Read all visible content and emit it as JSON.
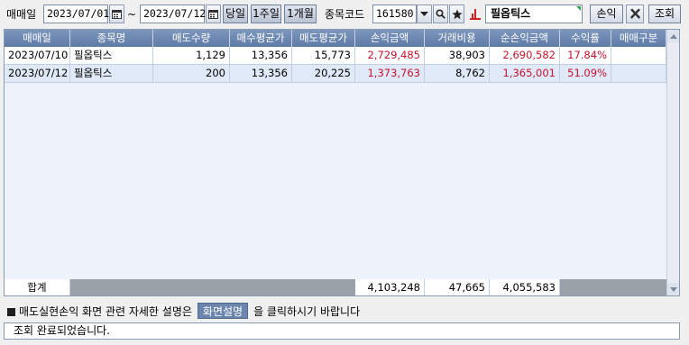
{
  "toolbar": {
    "date_label": "매매일",
    "start_date": "2023/07/01",
    "tilde": "~",
    "end_date": "2023/07/12",
    "btn_today": "당일",
    "btn_1week": "1주일",
    "btn_1month": "1개월",
    "code_label": "종목코드",
    "stock_code": "161580",
    "stock_name": "필옵틱스",
    "btn_profit": "손익",
    "btn_query": "조회"
  },
  "table": {
    "columns": [
      "매매일",
      "종목명",
      "매도수량",
      "매수평균가",
      "매도평균가",
      "손익금액",
      "거래비용",
      "순손익금액",
      "수익률",
      "매매구분"
    ],
    "rows": [
      [
        "2023/07/10",
        "필옵틱스",
        "1,129",
        "13,356",
        "15,773",
        "2,729,485",
        "38,903",
        "2,690,582",
        "17.84%",
        ""
      ],
      [
        "2023/07/12",
        "필옵틱스",
        "200",
        "13,356",
        "20,225",
        "1,373,763",
        "8,762",
        "1,365,001",
        "51.09%",
        ""
      ]
    ],
    "total": {
      "label": "합계",
      "profit": "4,103,248",
      "cost": "47,665",
      "net_profit": "4,055,583"
    }
  },
  "info": {
    "prefix": "매도실현손익 화면 관련 자세한 설명은",
    "help_button": "화면설명",
    "suffix": "을 클릭하시기 바랍니다"
  },
  "status": "조회 완료되었습니다.",
  "colors": {
    "header_bg": "#6b85ad",
    "profit_red": "#c8102e",
    "grid_bg": "#eef3fb"
  }
}
